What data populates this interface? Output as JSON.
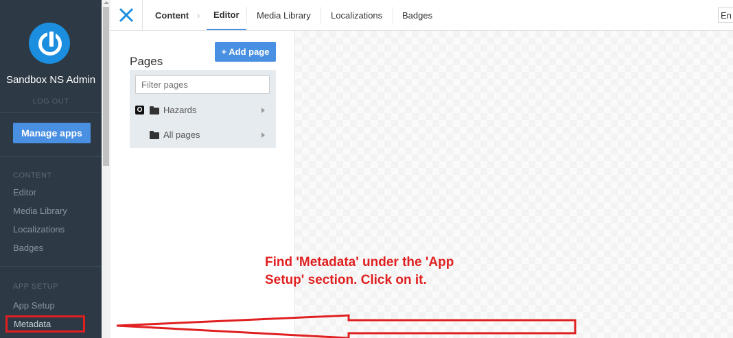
{
  "sidebar": {
    "app_name": "Sandbox NS Admin",
    "logout": "LOG OUT",
    "manage_apps": "Manage apps",
    "content_section": "CONTENT",
    "content_items": [
      "Editor",
      "Media Library",
      "Localizations",
      "Badges"
    ],
    "app_setup_section": "APP SETUP",
    "app_setup_items": [
      "App Setup",
      "Metadata"
    ]
  },
  "topbar": {
    "breadcrumb_root": "Content",
    "tabs": [
      "Editor",
      "Media Library",
      "Localizations",
      "Badges"
    ],
    "language": "En"
  },
  "pages": {
    "title": "Pages",
    "add_page": "+ Add page",
    "filter_placeholder": "Filter pages",
    "tree": [
      {
        "label": "Hazards",
        "badge": "O"
      },
      {
        "label": "All pages",
        "badge": ""
      }
    ]
  },
  "annotation": {
    "text": "Find 'Metadata' under the 'App Setup' section. Click on it.",
    "color": "#e02020"
  },
  "colors": {
    "sidebar_bg": "#2d3a45",
    "accent": "#4a90e2",
    "highlight": "#e02020"
  }
}
